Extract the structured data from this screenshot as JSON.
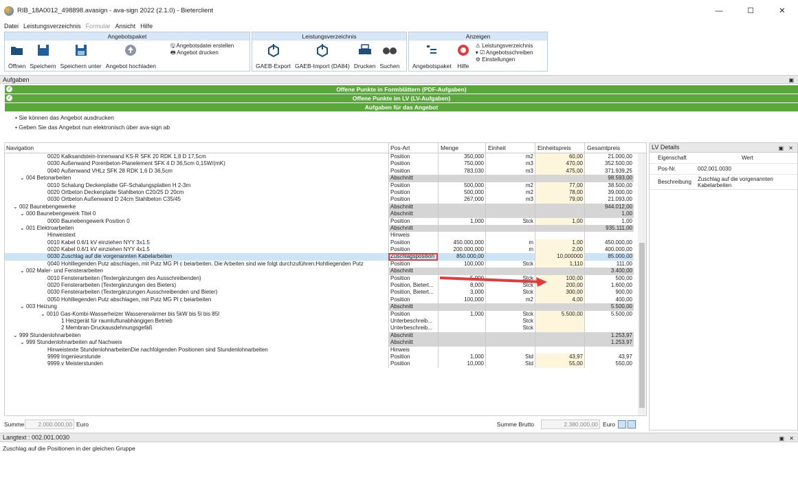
{
  "window": {
    "title": "RIB_18A0012_498898.avasign - ava-sign 2022 (2.1.0) - Bieterclient",
    "minimize": "—",
    "maximize": "☐",
    "close": "✕"
  },
  "menu": [
    "Datei",
    "Leistungsverzeichnis",
    "Formular",
    "Ansicht",
    "Hilfe"
  ],
  "ribbon": {
    "angebotspaket": {
      "title": "Angebotspaket",
      "buttons": [
        "Öffnen",
        "Speichern",
        "Speichern unter",
        "Angebot hochladen"
      ],
      "small": [
        "Angebotsdatei erstellen",
        "Angebot drucken"
      ]
    },
    "leistungsverzeichnis": {
      "title": "Leistungsverzeichnis",
      "buttons": [
        "GAEB-Export",
        "GAEB-Import (DA84)",
        "Drucken",
        "Suchen"
      ]
    },
    "anzeigen": {
      "title": "Anzeigen",
      "buttons": [
        "Angebotspaket",
        "Hilfe"
      ],
      "small": [
        "Leistungsverzeichnis",
        "Angebotsschreiben",
        "Einstellungen"
      ]
    }
  },
  "aufgaben": {
    "title": "Aufgaben",
    "rows": [
      "Offene Punkte in Formblättern (PDF-Aufgaben)",
      "Offene Punkte im LV (LV-Aufgaben)",
      "Aufgaben für das Angebot"
    ],
    "bullets": [
      "Sie können das Angebot ausdrucken",
      "Geben Sie das Angebot nun elektronisch über ava-sign ab"
    ]
  },
  "nav": {
    "headers": [
      "Navigation",
      "Pos-Art",
      "Menge",
      "Einheit",
      "Einheitspreis",
      "Gesamtpreis"
    ],
    "rows": [
      [
        "0020 Kalksandstein-Innenwand KS-R SFK 20 RDK 1,8 D 17,5cm",
        "Position",
        "350,000",
        "m2",
        "60,00",
        "21.000,00",
        3,
        "p"
      ],
      [
        "0030 Außenwand Porenbeton-Planelement SFK 4 D 36,5cm 0,15W/(mK)",
        "Position",
        "750,000",
        "m3",
        "470,00",
        "352.500,00",
        3,
        "p"
      ],
      [
        "0040 Außenwand VHLz SFK 28 RDK 1,6 D 36,5cm",
        "Position",
        "783,030",
        "m3",
        "475,00",
        "371.939,25",
        3,
        "p"
      ],
      [
        "004 Betonarbeiten",
        "Abschnitt",
        "",
        "",
        "",
        "98.593,00",
        1,
        "s"
      ],
      [
        "0010 Schalung Deckenplatte GF-Schalungsplatten H 2-3m",
        "Position",
        "500,000",
        "m2",
        "77,00",
        "38.500,00",
        3,
        "p"
      ],
      [
        "0020 Ortbeton Deckenplatte Stahlbeton C20/25 D 20cm",
        "Position",
        "500,000",
        "m2",
        "78,00",
        "39.000,00",
        3,
        "p"
      ],
      [
        "0030 Ortbeton Außenwand D 24cm Stahlbeton C35/45",
        "Position",
        "267,000",
        "m3",
        "79,00",
        "21.093,00",
        3,
        "p"
      ],
      [
        "002 Baunebengewerke",
        "Abschnitt",
        "",
        "",
        "",
        "944.012,00",
        0,
        "s"
      ],
      [
        "000 Baunebengewerk Titel 0",
        "Abschnitt",
        "",
        "",
        "",
        "1,00",
        1,
        "s"
      ],
      [
        "0000 Baunebengewerk Position 0",
        "Position",
        "1,000",
        "Stck",
        "1,00",
        "1,00",
        3,
        "p"
      ],
      [
        "001 Elektroarbeiten",
        "Abschnitt",
        "",
        "",
        "",
        "935.111,00",
        1,
        "s"
      ],
      [
        "Hinweistext",
        "Hinweis",
        "",
        "",
        "",
        "",
        3,
        "h"
      ],
      [
        "0010 Kabel 0.6/1 kV einziehen NYY 3x1.5",
        "Position",
        "450.000,000",
        "m",
        "1,00",
        "450.000,00",
        3,
        "p"
      ],
      [
        "0020 Kabel 0.6/1 kV einziehen NYY 4x1.5",
        "Position",
        "200.000,000",
        "m",
        "2,00",
        "400.000,00",
        3,
        "p"
      ],
      [
        "0030 Zuschlag auf die vorgenannten Kabelarbeiten",
        "Zuschlagsposition",
        "850.000,00",
        "",
        "10,000000",
        "85.000,00",
        3,
        "sel"
      ],
      [
        "0040 Hohlliegenden Putz abschlagen, mit Putz MG Pl c beiarbeiten. Die Arbeiten sind wie folgt durchzuführen:Hohlliegenden Putz",
        "Position",
        "100,000",
        "Stck",
        "1,110",
        "111,00",
        3,
        "p"
      ],
      [
        "002 Maler- und Fensterarbeiten",
        "Abschnitt",
        "",
        "",
        "",
        "3.400,00",
        1,
        "s"
      ],
      [
        "0010 Fensterarbeiten (Textergänzungen des Ausschreibenden)",
        "Position",
        "5,000",
        "Stck",
        "100,00",
        "500,00",
        3,
        "p"
      ],
      [
        "0020 Fensterarbeiten (Textergänzungen des Bieters)",
        "Position, Bietert...",
        "8,000",
        "Stck",
        "200,00",
        "1.600,00",
        3,
        "p"
      ],
      [
        "0030 Fensterarbeiten (Textergänzungen Ausschreibenden und Bieter)",
        "Position, Bietert...",
        "3,000",
        "Stck",
        "300,00",
        "900,00",
        3,
        "p"
      ],
      [
        "0050 Hohlliegenden Putz abschlagen, mit Putz MG Pl c beiarbeiten",
        "Position",
        "100,000",
        "m2",
        "4,00",
        "400,00",
        3,
        "p"
      ],
      [
        "003 Heizung",
        "Abschnitt",
        "",
        "",
        "",
        "5.500,00",
        1,
        "s"
      ],
      [
        "0010 Gas-Kombi-Wasserheizer Wassererwärmer bis 5kW bis 5l bis 85l",
        "Position",
        "1,000",
        "Stck",
        "5.500,00",
        "5.500,00",
        2,
        "p"
      ],
      [
        "1 Heizgerät für raumluftunabhängigen Betrieb",
        "Unterbeschreib...",
        "",
        "Stck",
        "",
        "",
        4,
        "u"
      ],
      [
        "2 Membran-Druckausdehnungsgefäß",
        "Unterbeschreib...",
        "",
        "Stck",
        "",
        "",
        4,
        "u"
      ],
      [
        "999 Stundenlohnarbeiten",
        "Abschnitt",
        "",
        "",
        "",
        "1.253,97",
        0,
        "s"
      ],
      [
        "999 Stundenlohnarbeiten auf Nachweis",
        "Abschnitt",
        "",
        "",
        "",
        "1.253,97",
        1,
        "s"
      ],
      [
        "Hinweistexte StundenlohnarbeitenDie nachfolgenden Positionen sind Stundenlohnarbeiten",
        "Hinweis",
        "",
        "",
        "",
        "",
        3,
        "h"
      ],
      [
        "9999 Ingenieurstunde",
        "Position",
        "1,000",
        "Std",
        "43,97",
        "43,97",
        3,
        "p"
      ],
      [
        "9999.v Meisterstunden",
        "Position",
        "10,000",
        "Std",
        "55,00",
        "550,00",
        3,
        "p"
      ]
    ]
  },
  "lv_details": {
    "title": "LV Details",
    "col_key": "Eigenschaft",
    "col_val": "Wert",
    "rows": [
      [
        "Pos-Nr.",
        "002.001.0030"
      ],
      [
        "Beschreibung",
        "Zuschlag auf die vorgenannten Kabelarbeiten"
      ]
    ]
  },
  "summe": {
    "label": "Summe",
    "value": "2.000.000,00",
    "unit": "Euro",
    "brutto_label": "Summe Brutto",
    "brutto_value": "2.380.000,00",
    "brutto_unit": "Euro"
  },
  "langtext": {
    "title": "Langtext : 002.001.0030",
    "text": "Zuschlag auf die Positionen in der gleichen Gruppe"
  },
  "colors": {
    "green": "#5aa83c",
    "ribbon_head": "#d7e7f6",
    "selected": "#cde4f7",
    "highlight": "#e23b3b"
  }
}
